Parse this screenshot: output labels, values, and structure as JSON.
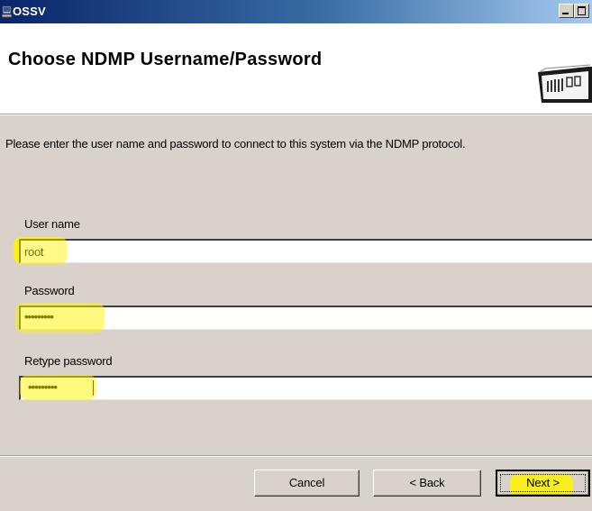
{
  "window": {
    "title": "OSSV"
  },
  "header": {
    "title": "Choose NDMP Username/Password"
  },
  "main": {
    "instructions": "Please enter the user name and password to connect to this system via the NDMP protocol.",
    "fields": {
      "username": {
        "label": "User name",
        "value": "root"
      },
      "password": {
        "label": "Password",
        "value": "•••••••••"
      },
      "retype_password": {
        "label": "Retype password",
        "value": "•••••••••"
      }
    }
  },
  "buttons": {
    "cancel": "Cancel",
    "back": "< Back",
    "next": "Next >"
  },
  "icons": {
    "app": "computer-icon",
    "logo": "storage-system-icon"
  },
  "colors": {
    "titlebar_start": "#0a246a",
    "titlebar_end": "#a6caf0",
    "highlight": "#fff500",
    "dialog_bg": "#d8d2cb"
  }
}
